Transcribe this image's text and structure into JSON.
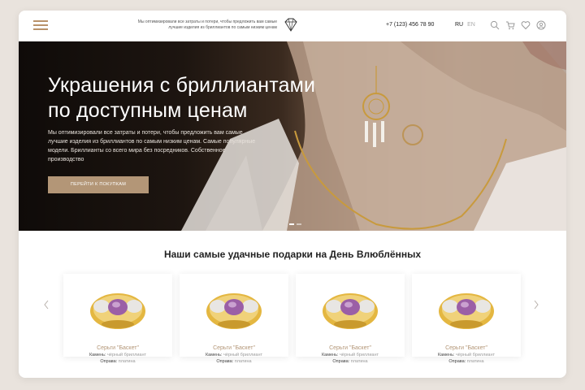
{
  "header": {
    "tagline": "Мы оптимизировали все затраты и потери, чтобы предложить вам самые лучшие изделия из бриллиантов по самым низким ценам",
    "phone": "+7 (123) 456 78 90",
    "lang_active": "RU",
    "lang_inactive": "EN",
    "icons": [
      "search-icon",
      "cart-icon",
      "heart-icon",
      "user-icon"
    ]
  },
  "hero": {
    "title": "Украшения с бриллиантами по доступным ценам",
    "description": "Мы оптимизировали все затраты и потери, чтобы предложить вам самые лучшие изделия из бриллиантов по самым низким ценам. Самые популярные модели. Бриллианты со всего мира без посредников. Собственное производство",
    "button": "ПЕРЕЙТИ К ПОКУПКАМ"
  },
  "section": {
    "title": "Наши самые удачные подарки на День Влюблённых"
  },
  "products": [
    {
      "name": "Серьги \"Баскет\"",
      "stone_label": "Камень:",
      "stone": "чёрный бриллиант",
      "setting_label": "Оправа:",
      "setting": "платина"
    },
    {
      "name": "Серьги \"Баскет\"",
      "stone_label": "Камень:",
      "stone": "чёрный бриллиант",
      "setting_label": "Оправа:",
      "setting": "платина"
    },
    {
      "name": "Серьги \"Баскет\"",
      "stone_label": "Камень:",
      "stone": "чёрный бриллиант",
      "setting_label": "Оправа:",
      "setting": "платина"
    },
    {
      "name": "Серьги \"Баскет\"",
      "stone_label": "Камень:",
      "stone": "чёрный бриллиант",
      "setting_label": "Оправа:",
      "setting": "платина"
    }
  ],
  "colors": {
    "accent": "#b39677",
    "page_bg": "#e9e3dd"
  }
}
